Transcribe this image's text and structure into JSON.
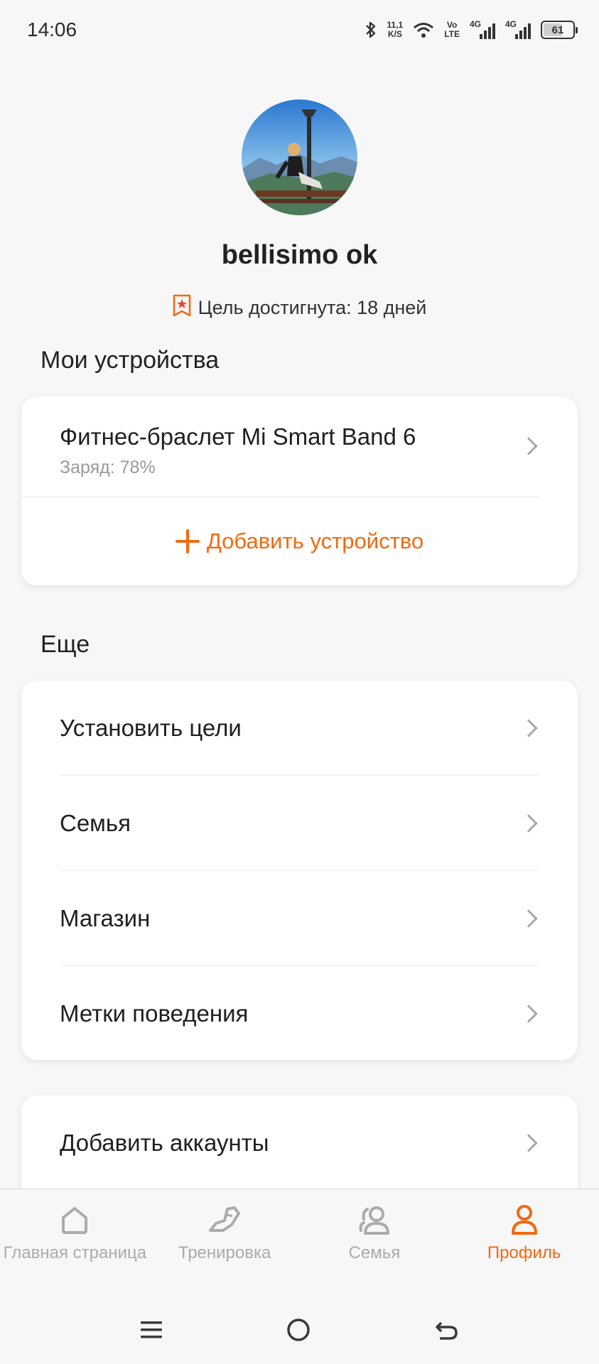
{
  "status_bar": {
    "time": "14:06",
    "net_speed_value": "11,1",
    "net_speed_unit": "K/S",
    "volte_top": "Vo",
    "volte_bottom": "LTE",
    "sim1_tag": "4G",
    "sim2_tag": "4G",
    "battery": "61"
  },
  "profile": {
    "username": "bellisimo ok",
    "goal_text": "Цель достигнута: 18 дней"
  },
  "devices_section": {
    "title": "Мои устройства",
    "device_name": "Фитнес-браслет Mi Smart Band 6",
    "device_battery": "Заряд: 78%",
    "add_device_label": "Добавить устройство"
  },
  "more_section": {
    "title": "Еще",
    "items": [
      {
        "label": "Установить цели"
      },
      {
        "label": "Семья"
      },
      {
        "label": "Магазин"
      },
      {
        "label": "Метки поведения"
      }
    ]
  },
  "accounts_card": {
    "label": "Добавить аккаунты"
  },
  "bottom_nav": {
    "items": [
      {
        "label": "Главная страница",
        "icon": "home-icon",
        "active": false
      },
      {
        "label": "Тренировка",
        "icon": "sneaker-icon",
        "active": false
      },
      {
        "label": "Семья",
        "icon": "family-icon",
        "active": false
      },
      {
        "label": "Профиль",
        "icon": "profile-icon",
        "active": true
      }
    ]
  },
  "colors": {
    "accent": "#f06a0f",
    "inactive": "#ababab",
    "background": "#f7f7f7"
  }
}
